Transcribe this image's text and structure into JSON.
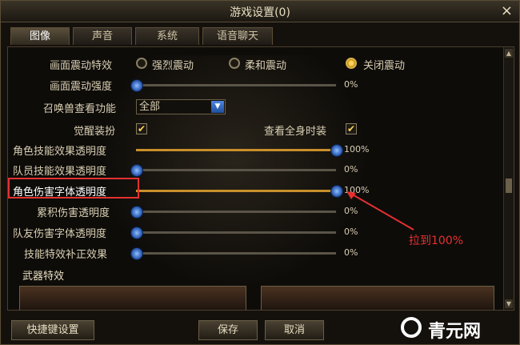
{
  "window": {
    "title": "游戏设置(0)",
    "close": "×"
  },
  "tabs": [
    "图像",
    "声音",
    "系统",
    "语音聊天"
  ],
  "settings": {
    "shake": {
      "label": "画面震动特效",
      "options": [
        "强烈震动",
        "柔和震动",
        "关闭震动"
      ],
      "selected": 2
    },
    "shake_strength": {
      "label": "画面震动强度",
      "value": 0,
      "display": "0%"
    },
    "summon": {
      "label": "召唤兽查看功能",
      "value": "全部"
    },
    "awaken": {
      "label": "觉醒装扮",
      "checked": true
    },
    "full_outfit": {
      "label": "查看全身时装",
      "checked": true
    },
    "sliders": [
      {
        "label": "角色技能效果透明度",
        "value": 100,
        "display": "100%"
      },
      {
        "label": "队员技能效果透明度",
        "value": 0,
        "display": "0%"
      },
      {
        "label": "角色伤害字体透明度",
        "value": 100,
        "display": "100%"
      },
      {
        "label": "累积伤害透明度",
        "value": 0,
        "display": "0%"
      },
      {
        "label": "队友伤害字体透明度",
        "value": 0,
        "display": "0%"
      },
      {
        "label": "技能特效补正效果",
        "value": 0,
        "display": "0%"
      }
    ],
    "weapon_title": "武器特效"
  },
  "buttons": {
    "shortcut": "快捷键设置",
    "save": "保存",
    "cancel": "取消"
  },
  "annotation": "拉到100%",
  "brand": {
    "name": "青元网"
  },
  "colors": {
    "highlight": "#e53030",
    "accent": "#c88f2a",
    "knob": "#2f5fb5"
  }
}
